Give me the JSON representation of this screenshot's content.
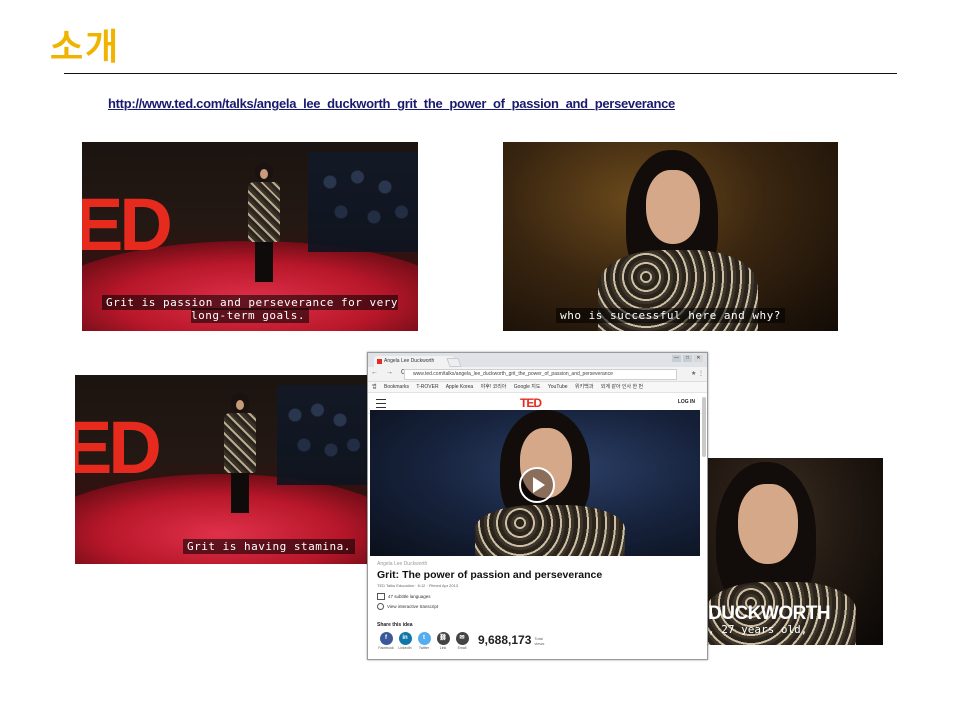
{
  "slide": {
    "title": "소개",
    "link": "http://www.ted.com/talks/angela_lee_duckworth_grit_the_power_of_passion_and_perseverance"
  },
  "frames": [
    {
      "subtitle": "Grit is passion and perseverance for very long-term goals."
    },
    {
      "subtitle": "who is successful here and why?"
    },
    {
      "subtitle": "Grit is having stamina."
    },
    {
      "lower_third": "DUCKWORTH",
      "subtitle": ", 27 years old,"
    }
  ],
  "ted_letters": "ED",
  "browser": {
    "tab_title": "Angela Lee Duckworth",
    "window_controls": [
      "—",
      "□",
      "✕"
    ],
    "nav_glyphs": "← → C",
    "url": "www.ted.com/talks/angela_lee_duckworth_grit_the_power_of_passion_and_perseverance",
    "bookmarks": [
      "앱",
      "Bookmarks",
      "T-ROVER",
      "Apple Korea",
      "야후! 코리아",
      "Google 지도",
      "YouTube",
      "위키백과",
      "외계 같아 인사 한 번"
    ],
    "brand": "TED",
    "login": "LOG IN",
    "speaker": "Angela Lee Duckworth",
    "talk_title": "Grit: The power of passion and perseverance",
    "talk_sub": "TED Talks Education · 6:12 · Filmed Apr 2013",
    "subtitle_languages": "47 subtitle languages",
    "transcript": "View interactive transcript",
    "share_heading": "Share this idea",
    "share": [
      {
        "label": "Facebook",
        "glyph": "f",
        "color": "#3b5998"
      },
      {
        "label": "LinkedIn",
        "glyph": "in",
        "color": "#0e76a8"
      },
      {
        "label": "Twitter",
        "glyph": "t",
        "color": "#55acee"
      },
      {
        "label": "Link",
        "glyph": "⛓",
        "color": "#444444"
      },
      {
        "label": "Email",
        "glyph": "✉",
        "color": "#444444"
      }
    ],
    "views": "9,688,173",
    "views_label": "Total views"
  },
  "colors": {
    "title": "#f0b400",
    "ted_red": "#e62b1e",
    "link": "#1a1a6e"
  }
}
